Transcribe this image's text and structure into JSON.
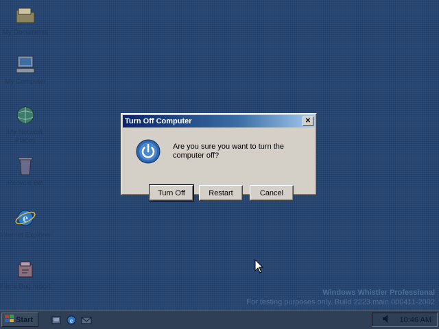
{
  "desktop": {
    "icons": [
      {
        "label": "My Documents"
      },
      {
        "label": "My Computer"
      },
      {
        "label": "My Network Places"
      },
      {
        "label": "Recycle Bin"
      },
      {
        "label": "Internet Explorer"
      },
      {
        "label": "File a Bug report"
      }
    ]
  },
  "dialog": {
    "title": "Turn Off Computer",
    "close_label": "✕",
    "message": "Are you sure you want to turn the computer off?",
    "buttons": {
      "turn_off": "Turn Off",
      "restart": "Restart",
      "cancel": "Cancel"
    }
  },
  "watermark": {
    "line1": "Windows Whistler Professional",
    "line2": "For testing purposes only. Build 2223.main.000411-2002"
  },
  "taskbar": {
    "start_label": "Start",
    "clock": "10:46 AM"
  },
  "colors": {
    "desktop_bg": "#2a4a78",
    "dialog_bg": "#d4d0c8",
    "titlebar_start": "#0a246a",
    "titlebar_end": "#a6caf0",
    "taskbar_bg": "#2f3f55"
  }
}
